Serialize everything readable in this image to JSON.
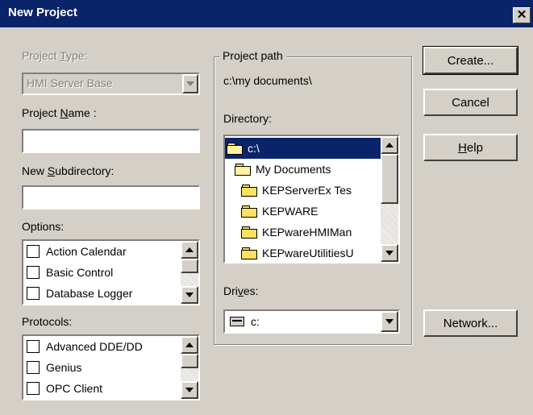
{
  "window": {
    "title": "New Project",
    "close_glyph": "✕"
  },
  "left": {
    "project_type_label_pre": "Project ",
    "project_type_label_ul": "T",
    "project_type_label_post": "ype:",
    "project_type_value": "HMI Server Base",
    "project_name_label_pre": "Project ",
    "project_name_label_ul": "N",
    "project_name_label_post": "ame :",
    "project_name_value": "",
    "subdir_label_pre": "New ",
    "subdir_label_ul": "S",
    "subdir_label_post": "ubdirectory:",
    "subdir_value": "",
    "options_label": "Options:",
    "options": [
      "Action Calendar",
      "Basic Control",
      "Database Logger"
    ],
    "protocols_label": "Protocols:",
    "protocols": [
      "Advanced DDE/DD",
      "Genius",
      "OPC Client"
    ]
  },
  "middle": {
    "project_path_label": "Project path",
    "project_path_value": "c:\\my documents\\",
    "directory_label": "Directory:",
    "directories": [
      {
        "name": "c:\\",
        "icon": "open-folder-icon",
        "selected": true
      },
      {
        "name": "My Documents",
        "icon": "open-folder-icon",
        "selected": false
      },
      {
        "name": "KEPServerEx Tes",
        "icon": "folder-icon",
        "selected": false
      },
      {
        "name": "KEPWARE",
        "icon": "folder-icon",
        "selected": false
      },
      {
        "name": "KEPwareHMIMan",
        "icon": "folder-icon",
        "selected": false
      },
      {
        "name": "KEPwareUtilitiesU",
        "icon": "folder-icon",
        "selected": false
      }
    ],
    "drives_label_pre": "Dri",
    "drives_label_ul": "v",
    "drives_label_post": "es:",
    "drive_value": "c:"
  },
  "buttons": {
    "create": "Create...",
    "cancel": "Cancel",
    "help_ul": "H",
    "help_post": "elp",
    "network": "Network..."
  },
  "colors": {
    "titlebar": "#0a246a",
    "face": "#d4d0c8",
    "selection": "#0a246a"
  }
}
